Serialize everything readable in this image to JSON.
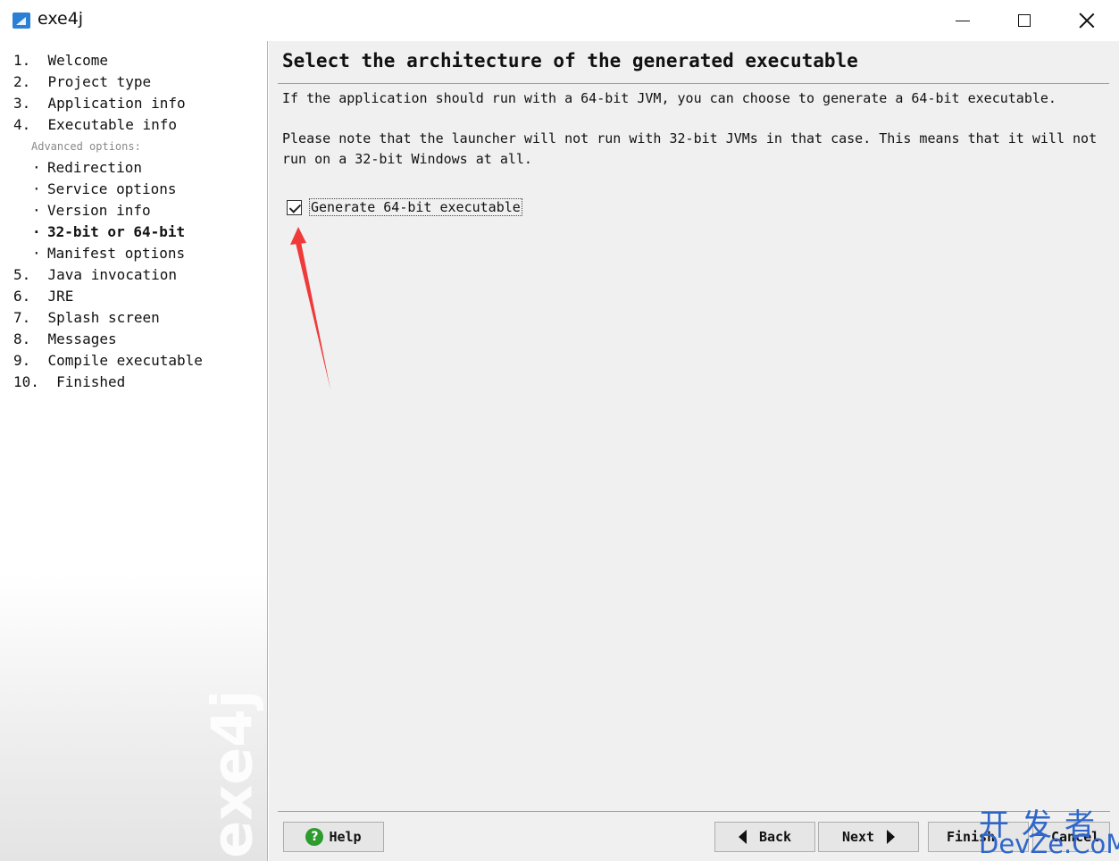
{
  "window": {
    "title": "exe4j"
  },
  "sidebar": {
    "steps": [
      "1.  Welcome",
      "2.  Project type",
      "3.  Application info",
      "4.  Executable info"
    ],
    "advanced_label": "Advanced options:",
    "advanced_items": [
      "Redirection",
      "Service options",
      "Version info",
      "32-bit or 64-bit",
      "Manifest options"
    ],
    "active_item": "32-bit or 64-bit",
    "steps_after": [
      "5.  Java invocation",
      "6.  JRE",
      "7.  Splash screen",
      "8.  Messages",
      "9.  Compile executable",
      "10.  Finished"
    ],
    "watermark": "exe4j"
  },
  "main": {
    "title": "Select the architecture of the generated executable",
    "paragraph1": "If the application should run with a 64-bit JVM, you can choose to generate a 64-bit executable.",
    "paragraph2": "Please note that the launcher will not run with 32-bit JVMs in that case. This means that it will not run on a 32-bit Windows at all.",
    "checkbox": {
      "label": "Generate 64-bit executable",
      "checked": true
    }
  },
  "buttons": {
    "help": "Help",
    "back": "Back",
    "next": "Next",
    "finish": "Finish",
    "cancel": "Cancel"
  },
  "overlay": {
    "site_cn": "开发者",
    "site_en": "DevZe.CoM",
    "arrow_color": "#f03a3a"
  }
}
